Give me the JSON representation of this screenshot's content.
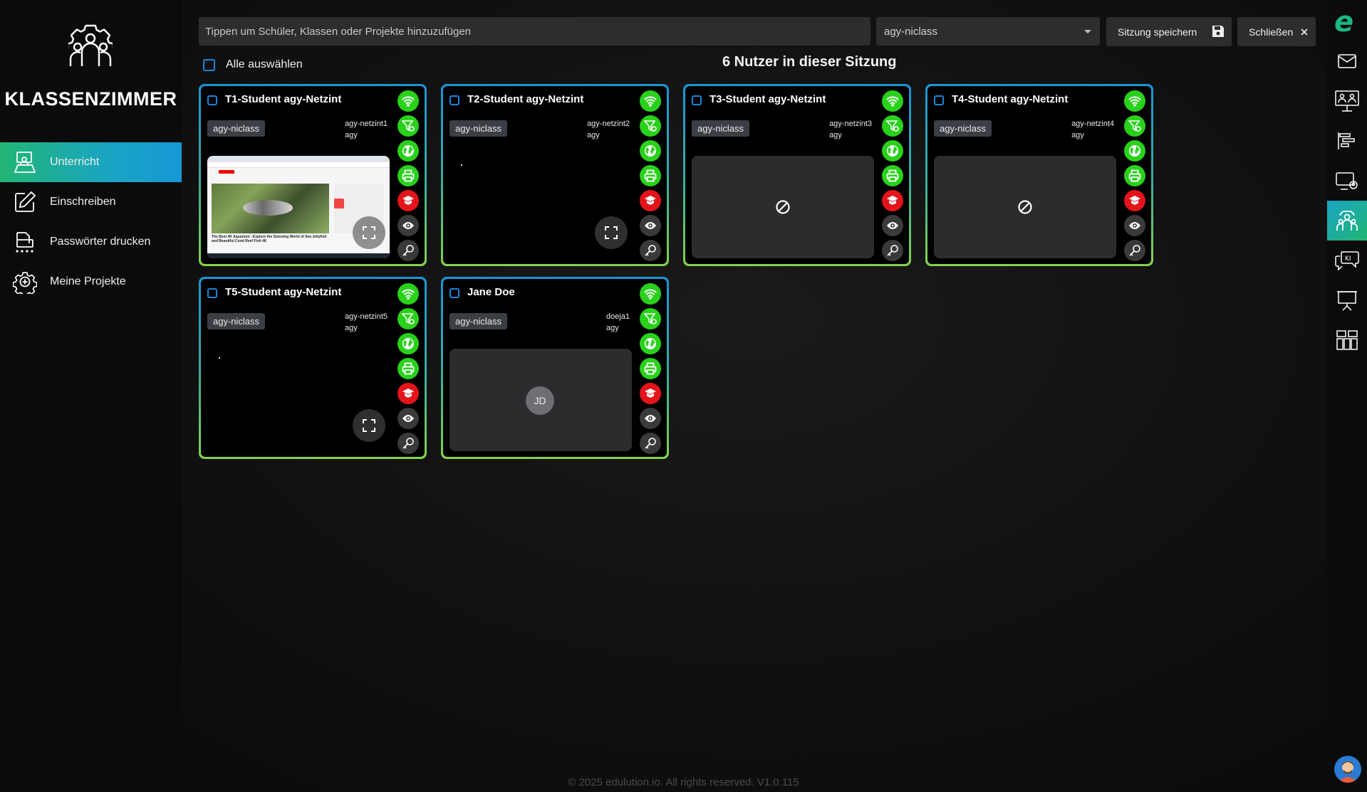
{
  "sidebar": {
    "title": "KLASSENZIMMER",
    "items": [
      {
        "label": "Unterricht",
        "active": true,
        "icon": "classroom-icon"
      },
      {
        "label": "Einschreiben",
        "active": false,
        "icon": "pencil-edit-icon"
      },
      {
        "label": "Passwörter drucken",
        "active": false,
        "icon": "password-print-icon"
      },
      {
        "label": "Meine Projekte",
        "active": false,
        "icon": "project-gear-icon"
      }
    ]
  },
  "topbar": {
    "search_placeholder": "Tippen um Schüler, Klassen oder Projekte hinzuzufügen",
    "group_value": "agy-niclass",
    "save_label": "Sitzung speichern",
    "close_label": "Schließen"
  },
  "session": {
    "select_all_label": "Alle auswählen",
    "count_label": "6 Nutzer in dieser Sitzung"
  },
  "students": [
    {
      "name": "T1-Student agy-Netzint",
      "group": "agy-niclass",
      "login": "agy-netzint1",
      "school": "agy",
      "screen": "live-browser"
    },
    {
      "name": "T2-Student agy-Netzint",
      "group": "agy-niclass",
      "login": "agy-netzint2",
      "school": "agy",
      "screen": "black"
    },
    {
      "name": "T3-Student agy-Netzint",
      "group": "agy-niclass",
      "login": "agy-netzint3",
      "school": "agy",
      "screen": "offline"
    },
    {
      "name": "T4-Student agy-Netzint",
      "group": "agy-niclass",
      "login": "agy-netzint4",
      "school": "agy",
      "screen": "offline"
    },
    {
      "name": "T5-Student agy-Netzint",
      "group": "agy-niclass",
      "login": "agy-netzint5",
      "school": "agy",
      "screen": "black"
    },
    {
      "name": "Jane Doe",
      "group": "agy-niclass",
      "login": "doeja1",
      "school": "agy",
      "screen": "avatar",
      "initials": "JD"
    }
  ],
  "card_actions": [
    {
      "icon": "wifi-icon",
      "color": "#29d11b"
    },
    {
      "icon": "web-filter-icon",
      "color": "#29d11b"
    },
    {
      "icon": "globe-icon",
      "color": "#29d11b"
    },
    {
      "icon": "printer-icon",
      "color": "#29d11b"
    },
    {
      "icon": "exam-mode-icon",
      "color": "#e3141a"
    },
    {
      "icon": "eye-icon",
      "color": "#3a3a3a"
    },
    {
      "icon": "key-icon",
      "color": "#3a3a3a"
    }
  ],
  "thumbnail": {
    "video_title": "The Best 4K Aquarium - Explore the Stunning World of Sea Jellyfish and Beautiful Coral Reef Fish 4K"
  },
  "rail": {
    "logo": "e",
    "items": [
      "mail-icon",
      "users-board-icon",
      "gantt-chart-icon",
      "monitor-user-icon",
      "classroom-rail-icon",
      "ai-chat-icon",
      "presentation-board-icon",
      "file-grid-icon"
    ],
    "active_index": 4
  },
  "footer": "© 2025 edulution.io. All rights reserved. V1.0.115",
  "colors": {
    "accent_green": "#29d11b",
    "accent_red": "#e3141a",
    "accent_blue": "#1b85d8"
  }
}
